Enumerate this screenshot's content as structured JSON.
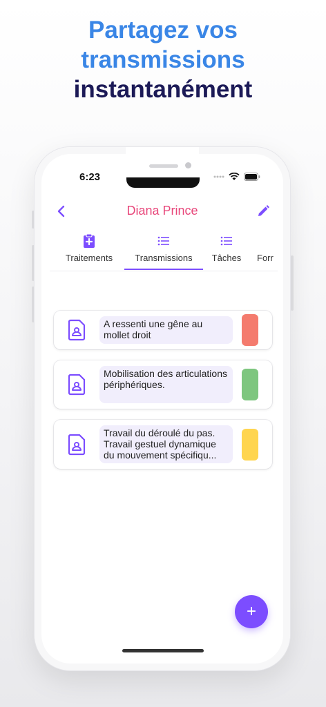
{
  "headline": {
    "line1": "Partagez vos",
    "line2": "transmissions",
    "line3": "instantanément"
  },
  "status_bar": {
    "time": "6:23"
  },
  "app_bar": {
    "title": "Diana Prince"
  },
  "tabs": [
    {
      "label": "Traitements",
      "icon": "clipboard-plus-icon",
      "selected": false
    },
    {
      "label": "Transmissions",
      "icon": "list-icon",
      "selected": true
    },
    {
      "label": "Tâches",
      "icon": "list-icon",
      "selected": false
    },
    {
      "label": "Forr",
      "icon": "",
      "selected": false
    }
  ],
  "transmissions": [
    {
      "text": "A ressenti une gêne au mollet droit",
      "color": "#f47b6e"
    },
    {
      "text": "Mobilisation des articulations périphériques.",
      "color": "#7ec67f"
    },
    {
      "text": "Travail du déroulé du pas. Travail gestuel dynamique du mouvement spécifiqu...",
      "color": "#ffd54f"
    }
  ],
  "fab": {
    "label": "+"
  },
  "colors": {
    "accent": "#7c4dff",
    "title": "#e8467a",
    "headline_blue": "#3a86e6",
    "headline_dark": "#1c1a57"
  }
}
